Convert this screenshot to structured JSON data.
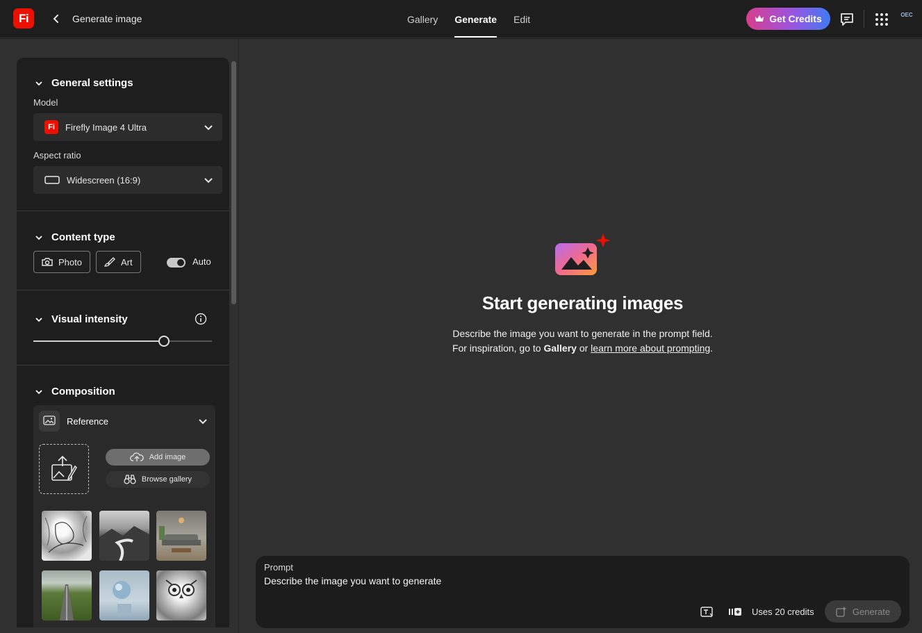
{
  "app": {
    "logo_text": "Fi",
    "page_title": "Generate image",
    "brand_color": "#eb1000"
  },
  "nav": {
    "tabs": [
      {
        "label": "Gallery",
        "active": false
      },
      {
        "label": "Generate",
        "active": true
      },
      {
        "label": "Edit",
        "active": false
      }
    ],
    "get_credits_label": "Get Credits",
    "org_badge": "OEC"
  },
  "settings": {
    "general": {
      "title": "General settings",
      "model_label": "Model",
      "model_value": "Firefly Image 4 Ultra",
      "model_icon_text": "Fi",
      "aspect_label": "Aspect ratio",
      "aspect_value": "Widescreen (16:9)"
    },
    "content_type": {
      "title": "Content type",
      "options": [
        "Photo",
        "Art"
      ],
      "auto_label": "Auto",
      "auto_on": true
    },
    "visual_intensity": {
      "title": "Visual intensity",
      "value_fraction": 0.73
    },
    "composition": {
      "title": "Composition",
      "reference_label": "Reference",
      "add_image_label": "Add image",
      "browse_gallery_label": "Browse gallery"
    }
  },
  "empty_state": {
    "title": "Start generating images",
    "line1": "Describe the image you want to generate in the prompt field.",
    "line2_prefix": "For inspiration, go to ",
    "line2_gallery": "Gallery",
    "line2_mid": " or ",
    "line2_link": "learn more about prompting",
    "line2_suffix": "."
  },
  "prompt": {
    "label": "Prompt",
    "placeholder": "Describe the image you want to generate",
    "credits_text": "Uses 20 credits",
    "generate_label": "Generate"
  }
}
